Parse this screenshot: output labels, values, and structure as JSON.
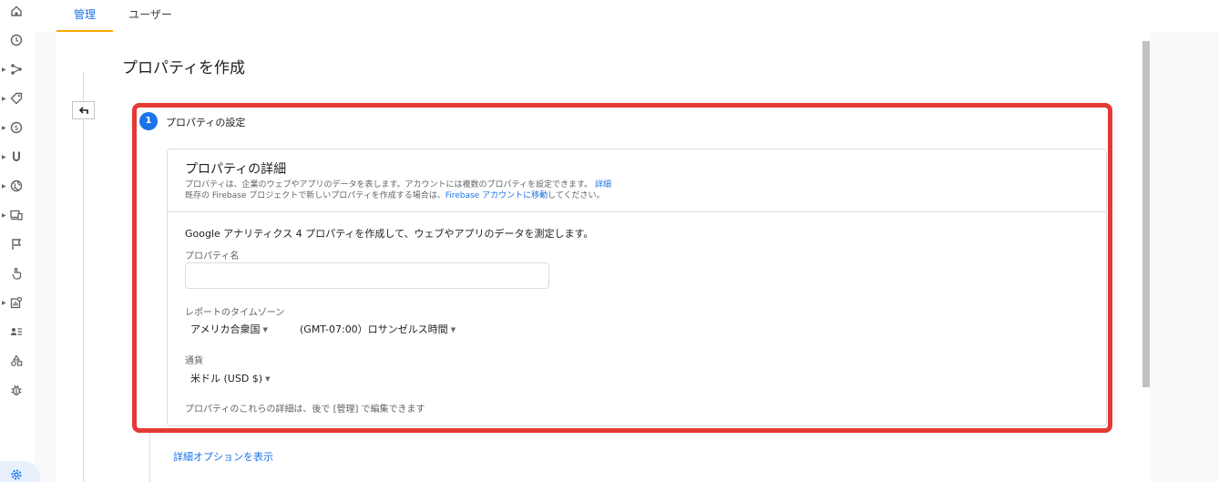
{
  "nav": {
    "items": [
      {
        "icon": "home-icon",
        "expandable": false
      },
      {
        "icon": "clock-icon",
        "expandable": false
      },
      {
        "icon": "share-nodes-icon",
        "expandable": true
      },
      {
        "icon": "tag-icon",
        "expandable": true
      },
      {
        "icon": "dollar-icon",
        "expandable": true
      },
      {
        "icon": "magnet-icon",
        "expandable": true
      },
      {
        "icon": "globe-icon",
        "expandable": true
      },
      {
        "icon": "devices-icon",
        "expandable": true
      },
      {
        "icon": "flag-icon",
        "expandable": false
      },
      {
        "icon": "touch-icon",
        "expandable": false
      },
      {
        "icon": "report-icon",
        "expandable": true
      },
      {
        "icon": "user-list-icon",
        "expandable": false
      },
      {
        "icon": "shapes-icon",
        "expandable": false
      },
      {
        "icon": "bug-icon",
        "expandable": false
      },
      {
        "icon": "gear-icon",
        "active": true
      }
    ]
  },
  "tabs": {
    "admin": "管理",
    "user": "ユーザー"
  },
  "page": {
    "title": "プロパティを作成",
    "step_number": "1",
    "step_label": "プロパティの設定"
  },
  "card": {
    "title": "プロパティの詳細",
    "desc1": "プロパティは、企業のウェブやアプリのデータを表します。アカウントには複数のプロパティを設定できます。",
    "desc1_link": "詳細",
    "desc2_prefix": "既存の Firebase プロジェクトで新しいプロパティを作成する場合は、",
    "desc2_link": "Firebase アカウントに移動",
    "desc2_suffix": "してください。",
    "intro": "Google アナリティクス 4 プロパティを作成して、ウェブやアプリのデータを測定します。",
    "property_name_label": "プロパティ名",
    "property_name_value": "",
    "timezone_label": "レポートのタイムゾーン",
    "timezone_country": "アメリカ合衆国",
    "timezone_zone": "(GMT-07:00）ロサンゼルス時間",
    "currency_label": "通貨",
    "currency_value": "米ドル (USD $)",
    "footnote": "プロパティのこれらの詳細は、後で [管理] で編集できます"
  },
  "more_options": "詳細オプションを表示",
  "colors": {
    "accent": "#1a73e8",
    "highlight": "#e53935",
    "tab_underline": "#f9ab00"
  }
}
